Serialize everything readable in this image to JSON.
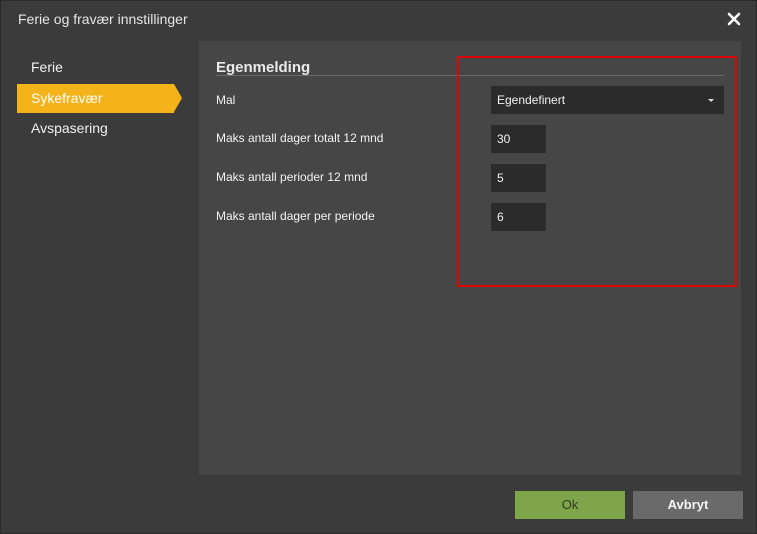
{
  "dialog": {
    "title": "Ferie og fravær innstillinger",
    "close_icon": "close-icon"
  },
  "sidebar": {
    "items": [
      {
        "label": "Ferie",
        "active": false
      },
      {
        "label": "Sykefravær",
        "active": true
      },
      {
        "label": "Avspasering",
        "active": false
      }
    ]
  },
  "section": {
    "title": "Egenmelding"
  },
  "form": {
    "template": {
      "label": "Mal",
      "value": "Egendefinert"
    },
    "max_days_12m": {
      "label": "Maks antall dager totalt 12 mnd",
      "value": "30"
    },
    "max_periods_12m": {
      "label": "Maks antall perioder 12 mnd",
      "value": "5"
    },
    "max_days_per_period": {
      "label": "Maks antall dager per periode",
      "value": "6"
    }
  },
  "buttons": {
    "ok": "Ok",
    "cancel": "Avbryt"
  },
  "colors": {
    "accent": "#f5b31a",
    "ok_button": "#7fa54a",
    "highlight_box": "#e00000"
  }
}
